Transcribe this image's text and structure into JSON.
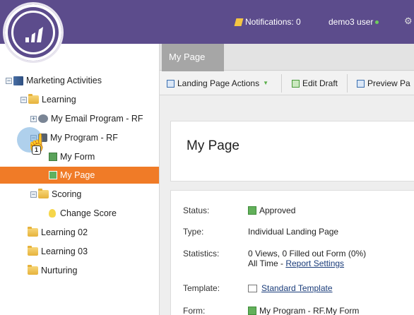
{
  "header": {
    "notifications_label": "Notifications: 0",
    "user_label": "demo3 user"
  },
  "tree": {
    "items": [
      {
        "label": "Marketing Activities"
      },
      {
        "label": "Learning"
      },
      {
        "label": "My Email Program - RF"
      },
      {
        "label": "My Program - RF"
      },
      {
        "label": "My Form"
      },
      {
        "label": "My Page"
      },
      {
        "label": "Scoring"
      },
      {
        "label": "Change Score"
      },
      {
        "label": "Learning 02"
      },
      {
        "label": "Learning 03"
      },
      {
        "label": "Nurturing"
      }
    ],
    "selected": "My Page",
    "cursor_badge": "1"
  },
  "tabs": [
    {
      "label": "My Page",
      "active": true
    }
  ],
  "toolbar": {
    "landing_page_actions": "Landing Page Actions",
    "edit_draft": "Edit Draft",
    "preview": "Preview Pa"
  },
  "page": {
    "title": "My Page",
    "details": {
      "status_key": "Status:",
      "status_val": "Approved",
      "type_key": "Type:",
      "type_val": "Individual Landing Page",
      "stats_key": "Statistics:",
      "stats_line1": "0 Views, 0 Filled out Form (0%)",
      "stats_line2_prefix": "All Time - ",
      "stats_link": "Report Settings",
      "template_key": "Template:",
      "template_val": "Standard Template",
      "form_key": "Form:",
      "form_val": "My Program - RF.My Form"
    }
  },
  "colors": {
    "topbar": "#5c4c8c",
    "selected": "#f07b27",
    "tab": "#a6a6a6"
  }
}
